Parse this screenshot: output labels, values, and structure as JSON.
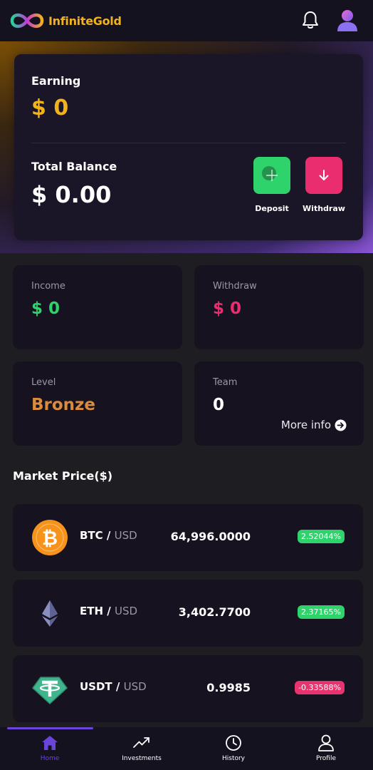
{
  "header": {
    "brand": "InfiniteGold",
    "logo_icon": "infinity-logo-icon",
    "notifications_icon": "bell-icon",
    "profile_icon": "user-avatar-icon"
  },
  "summary": {
    "earning_label": "Earning",
    "earning_value": "$ 0",
    "balance_label": "Total Balance",
    "balance_value": "$ 0.00",
    "deposit_label": "Deposit",
    "withdraw_label": "Withdraw"
  },
  "stats": {
    "income_label": "Income",
    "income_value": "$ 0",
    "withdraw_label": "Withdraw",
    "withdraw_value": "$ 0",
    "level_label": "Level",
    "level_value": "Bronze",
    "team_label": "Team",
    "team_value": "0",
    "more_info": "More info"
  },
  "market": {
    "title": "Market Price($)",
    "quote_sep": "/",
    "rows": [
      {
        "symbol": "BTC",
        "quote": "USD",
        "price": "64,996.0000",
        "change": "2.52044%",
        "direction": "up"
      },
      {
        "symbol": "ETH",
        "quote": "USD",
        "price": "3,402.7700",
        "change": "2.37165%",
        "direction": "up"
      },
      {
        "symbol": "USDT",
        "quote": "USD",
        "price": "0.9985",
        "change": "-0.33588%",
        "direction": "down"
      }
    ]
  },
  "nav": {
    "items": [
      {
        "label": "Home",
        "icon": "home-icon",
        "active": true
      },
      {
        "label": "Investments",
        "icon": "trending-up-icon",
        "active": false
      },
      {
        "label": "History",
        "icon": "clock-icon",
        "active": false
      },
      {
        "label": "Profile",
        "icon": "user-icon",
        "active": false
      }
    ]
  },
  "colors": {
    "accent_gold": "#f2b21c",
    "positive": "#2fd36b",
    "negative": "#ea2d6f",
    "level_bronze": "#d98b3e",
    "nav_active": "#6a45d9",
    "card_bg": "#16121f"
  }
}
